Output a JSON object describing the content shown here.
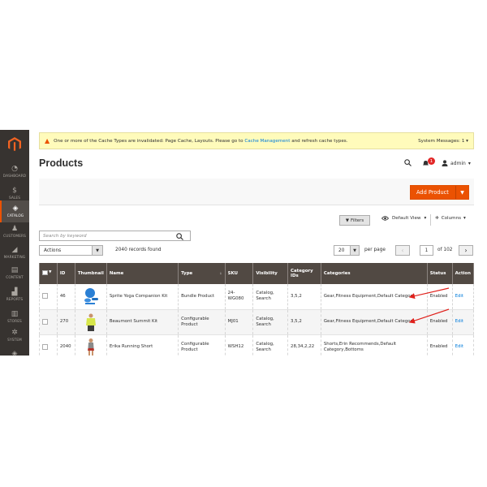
{
  "sidebar": {
    "items": [
      {
        "label": "DASHBOARD",
        "icon": "dashboard-icon",
        "glyph": "◔"
      },
      {
        "label": "SALES",
        "icon": "dollar-icon",
        "glyph": "$"
      },
      {
        "label": "CATALOG",
        "icon": "cube-icon",
        "glyph": "◈"
      },
      {
        "label": "CUSTOMERS",
        "icon": "person-icon",
        "glyph": "♟"
      },
      {
        "label": "MARKETING",
        "icon": "megaphone-icon",
        "glyph": "◢"
      },
      {
        "label": "CONTENT",
        "icon": "layout-icon",
        "glyph": "▤"
      },
      {
        "label": "REPORTS",
        "icon": "bar-chart-icon",
        "glyph": "▟"
      },
      {
        "label": "STORES",
        "icon": "store-icon",
        "glyph": "▥"
      },
      {
        "label": "SYSTEM",
        "icon": "gear-icon",
        "glyph": "✲"
      },
      {
        "label": "",
        "icon": "box-icon",
        "glyph": "◈"
      }
    ]
  },
  "notice": {
    "text_before": "One or more of the Cache Types are invalidated: Page Cache, Layouts. Please go to",
    "link": "Cache Management",
    "text_after": "and refresh cache types.",
    "system_messages": "System Messages: 1"
  },
  "header": {
    "title": "Products",
    "notification_count": "1",
    "user": "admin"
  },
  "toolbar": {
    "add_product": "Add Product",
    "filters": "Filters",
    "default_view": "Default View",
    "columns": "Columns",
    "search_placeholder": "Search by keyword",
    "actions": "Actions",
    "records_found": "2040 records found",
    "per_page_value": "20",
    "per_page_label": "per page",
    "page_current": "1",
    "page_of": "of 102"
  },
  "table": {
    "headers": {
      "id": "ID",
      "thumbnail": "Thumbnail",
      "name": "Name",
      "type": "Type",
      "sku": "SKU",
      "visibility": "Visibility",
      "category_ids": "Category IDs",
      "categories": "Categories",
      "status": "Status",
      "action": "Action"
    },
    "rows": [
      {
        "id": "46",
        "name": "Sprite Yoga Companion Kit",
        "type": "Bundle Product",
        "sku": "24-WG080",
        "visibility": "Catalog, Search",
        "category_ids": "3,5,2",
        "categories": "Gear,Fitness Equipment,Default Category",
        "status": "Enabled",
        "action": "Edit"
      },
      {
        "id": "270",
        "name": "Beaumont Summit Kit",
        "type": "Configurable Product",
        "sku": "MJ01",
        "visibility": "Catalog, Search",
        "category_ids": "3,5,2",
        "categories": "Gear,Fitness Equipment,Default Category",
        "status": "Enabled",
        "action": "Edit"
      },
      {
        "id": "2040",
        "name": "Erika Running Short",
        "type": "Configurable Product",
        "sku": "WSH12",
        "visibility": "Catalog, Search",
        "category_ids": "28,34,2,22",
        "categories": "Shorts,Erin Recommends,Default Category,Bottoms",
        "status": "Enabled",
        "action": "Edit"
      }
    ]
  },
  "colors": {
    "accent": "#eb5202",
    "sidebar": "#373330",
    "table_header": "#514943",
    "link": "#007bdb",
    "annotation_arrow": "#e0211c"
  }
}
